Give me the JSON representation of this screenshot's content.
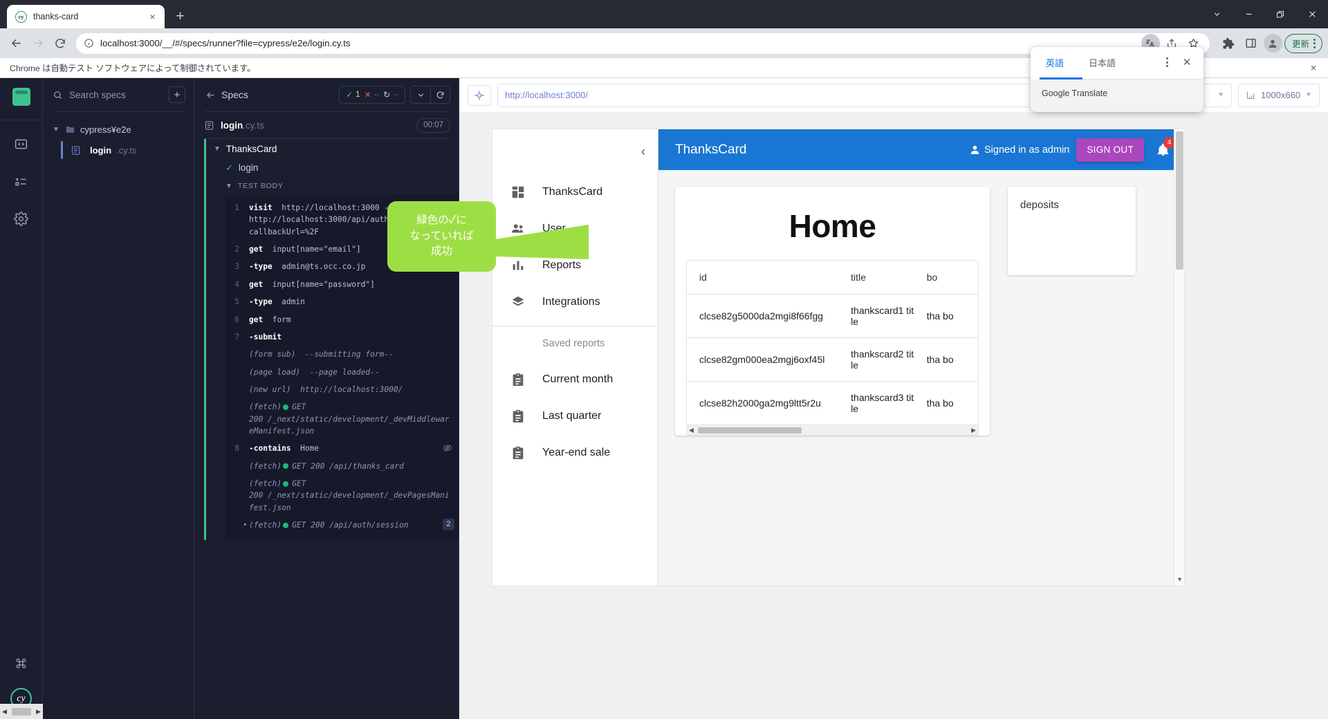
{
  "browser": {
    "tab": {
      "title": "thanks-card",
      "favicon": "cypress-favicon",
      "close": "×"
    },
    "new_tab": "+",
    "window_controls": {
      "minimize": "minimize-icon",
      "maximize": "restore-icon",
      "close": "close-icon",
      "more": "chevron-down-icon"
    },
    "nav": {
      "back": "back-arrow-icon",
      "forward": "forward-arrow-icon",
      "reload": "reload-icon"
    },
    "omnibox": {
      "info_icon": "info-circle-icon",
      "url": "localhost:3000/__/#/specs/runner?file=cypress/e2e/login.cy.ts",
      "translate_icon": "translate-icon",
      "share_icon": "share-icon",
      "bookmark_icon": "star-icon"
    },
    "toolbar_right": {
      "extensions_icon": "puzzle-icon",
      "sidepanel_icon": "side-panel-icon",
      "profile_icon": "avatar-icon",
      "update_label": "更新",
      "menu_icon": "kebab-menu-icon"
    },
    "infobar": {
      "text": "Chrome は自動テスト ソフトウェアによって制御されています。",
      "close": "×"
    },
    "translate_popup": {
      "tab_source": "英語",
      "tab_target": "日本語",
      "more_icon": "kebab-menu-icon",
      "close_icon": "close-icon",
      "footer": "Google Translate"
    }
  },
  "cypress": {
    "rail": {
      "logo": "cypress-logo",
      "items": [
        "specs-icon",
        "runs-icon",
        "settings-icon"
      ],
      "shortcut_icon": "command-key-icon",
      "badge": "cy"
    },
    "specs_panel": {
      "search_placeholder": "Search specs",
      "add_label": "+",
      "folder": "cypress¥e2e",
      "file_name": "login",
      "file_ext": ".cy.ts"
    },
    "reporter": {
      "back_icon": "collapse-left-icon",
      "title": "Specs",
      "stats": {
        "passed_icon": "check-icon",
        "passed": "1",
        "failed_icon": "x-icon",
        "failed": "--",
        "pending_icon": "pending-icon",
        "pending": "--"
      },
      "controls": {
        "collapse": "chevron-down-icon",
        "rerun": "restart-icon"
      },
      "spec_file_name": "login",
      "spec_file_ext": ".cy.ts",
      "timer": "00:07",
      "suite": "ThanksCard",
      "test": "login",
      "test_body_label": "TEST BODY",
      "commands": [
        {
          "num": "1",
          "kw": "visit",
          "arg": "http://localhost:3000 -> 307: http://localhost:3000/api/auth/signin?callbackUrl=%2F"
        },
        {
          "num": "2",
          "kw": "get",
          "arg": "input[name=\"email\"]"
        },
        {
          "num": "3",
          "kw": "-type",
          "arg": "admin@ts.occ.co.jp"
        },
        {
          "num": "4",
          "kw": "get",
          "arg": "input[name=\"password\"]"
        },
        {
          "num": "5",
          "kw": "-type",
          "arg": "admin"
        },
        {
          "num": "6",
          "kw": "get",
          "arg": "form"
        },
        {
          "num": "7",
          "kw": "-submit",
          "arg": ""
        }
      ],
      "logs_a": [
        {
          "grp": "(form sub)",
          "text": "--submitting form--"
        },
        {
          "grp": "(page load)",
          "text": "--page loaded--"
        },
        {
          "grp": "(new url)",
          "text": "http://localhost:3000/"
        },
        {
          "grp": "(fetch)",
          "status": "GET 200",
          "text": "/_next/static/development/_devMiddlewareManifest.json"
        }
      ],
      "command_contains": {
        "num": "8",
        "kw": "-contains",
        "arg": "Home",
        "eye_icon": "eye-off-icon"
      },
      "logs_b": [
        {
          "grp": "(fetch)",
          "status": "GET 200",
          "text": "/api/thanks_card"
        },
        {
          "grp": "(fetch)",
          "status": "GET 200",
          "text": "/_next/static/development/_devPagesManifest.json"
        },
        {
          "grp": "(fetch)",
          "status": "GET 200",
          "text": "/api/auth/session",
          "badge": "2",
          "expand_icon": "chevron-right-icon"
        }
      ],
      "callout": "緑色の✓になっていれば成功"
    },
    "preview": {
      "target_icon": "selector-playground-icon",
      "url": "http://localhost:3000/",
      "url_chevron": "chevron-down-icon",
      "viewport_icon": "ruler-icon",
      "viewport": "1000x660",
      "viewport_chevron": "chevron-down-icon"
    }
  },
  "app": {
    "drawer": {
      "collapse_icon": "chevron-left-icon",
      "items": [
        {
          "icon": "dashboard-icon",
          "label": "ThanksCard"
        },
        {
          "icon": "people-icon",
          "label": "User"
        },
        {
          "icon": "bar-chart-icon",
          "label": "Reports"
        },
        {
          "icon": "layers-icon",
          "label": "Integrations"
        }
      ],
      "section_label": "Saved reports",
      "saved": [
        {
          "icon": "assignment-icon",
          "label": "Current month"
        },
        {
          "icon": "assignment-icon",
          "label": "Last quarter"
        },
        {
          "icon": "assignment-icon",
          "label": "Year-end sale"
        }
      ]
    },
    "appbar": {
      "title": "ThanksCard",
      "user_icon": "person-icon",
      "signed_in": "Signed in as admin",
      "signout": "SIGN OUT",
      "bell_icon": "notifications-icon",
      "bell_count": "4",
      "accent": "#1976d2",
      "signout_color": "#ab47bc"
    },
    "home": {
      "title": "Home",
      "columns": [
        "id",
        "title",
        "bo"
      ],
      "rows": [
        {
          "id": "clcse82g5000da2mgi8f66fgg",
          "title": "thankscard1 title",
          "body": "tha bo"
        },
        {
          "id": "clcse82gm000ea2mgj6oxf45l",
          "title": "thankscard2 title",
          "body": "tha bo"
        },
        {
          "id": "clcse82h2000ga2mg9ltt5r2u",
          "title": "thankscard3 title",
          "body": "tha bo"
        }
      ],
      "scroll_left": "◀",
      "scroll_right": "▶"
    },
    "deposits": {
      "title": "deposits"
    }
  }
}
